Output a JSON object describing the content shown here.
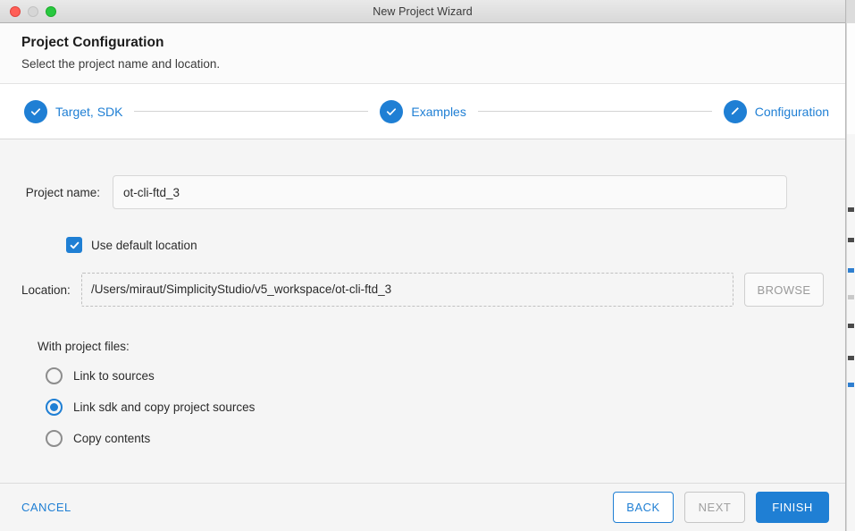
{
  "window": {
    "title": "New Project Wizard",
    "traffic_lights": [
      "close-button",
      "minimize-button",
      "maximize-button"
    ]
  },
  "header": {
    "title": "Project Configuration",
    "subtitle": "Select the project name and location."
  },
  "stepper": {
    "steps": [
      {
        "label": "Target, SDK",
        "icon": "check-icon",
        "state": "complete"
      },
      {
        "label": "Examples",
        "icon": "check-icon",
        "state": "complete"
      },
      {
        "label": "Configuration",
        "icon": "pencil-icon",
        "state": "current"
      }
    ]
  },
  "form": {
    "project_name": {
      "label": "Project name:",
      "value": "ot-cli-ftd_3",
      "placeholder": ""
    },
    "use_default_location": {
      "label": "Use default location",
      "checked": true
    },
    "location": {
      "label": "Location:",
      "value": "/Users/miraut/SimplicityStudio/v5_workspace/ot-cli-ftd_3",
      "placeholder": "",
      "browse_label": "BROWSE",
      "browse_enabled": false
    },
    "project_files": {
      "group_label": "With project files:",
      "options": [
        {
          "label": "Link to sources",
          "selected": false
        },
        {
          "label": "Link sdk and copy project sources",
          "selected": true
        },
        {
          "label": "Copy contents",
          "selected": false
        }
      ]
    }
  },
  "footer": {
    "cancel_label": "CANCEL",
    "back_label": "BACK",
    "next_label": "NEXT",
    "next_enabled": false,
    "finish_label": "FINISH"
  },
  "colors": {
    "accent": "#1f7fd4",
    "body_bg": "#f5f5f5",
    "panel_bg": "#ffffff",
    "text": "#2b2b2b",
    "disabled_text": "#9a9a9a"
  }
}
